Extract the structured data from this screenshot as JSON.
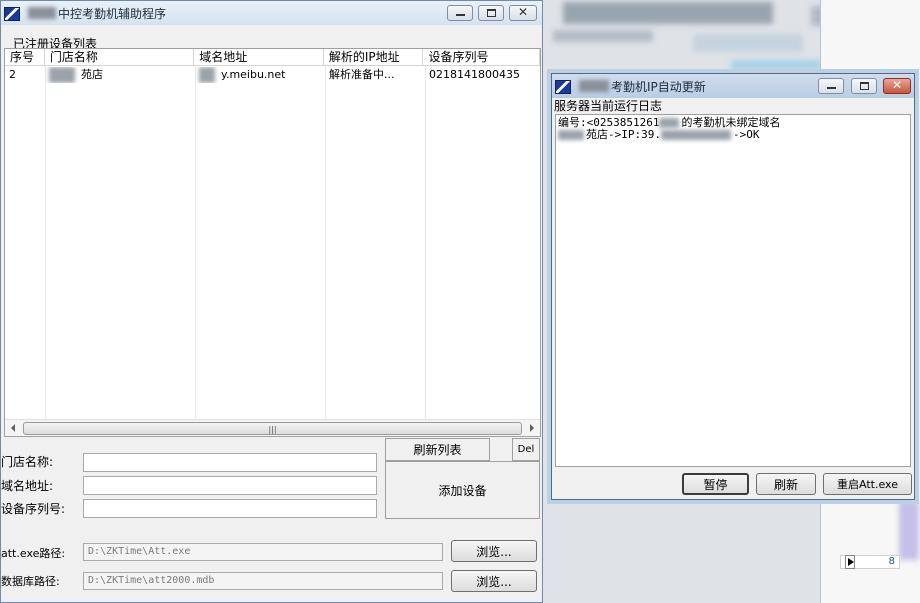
{
  "main_window": {
    "title": "中控考勤机辅助程序",
    "group_label": "已注册设备列表",
    "columns": [
      "序号",
      "门店名称",
      "域名地址",
      "解析的IP地址",
      "设备序列号"
    ],
    "rows": [
      {
        "index": "2",
        "store": "苑店",
        "domain": "y.meibu.net",
        "ip": "解析准备中...",
        "serial": "0218141800435"
      }
    ],
    "form": {
      "store_label": "门店名称:",
      "domain_label": "域名地址:",
      "serial_label": "设备序列号:",
      "store_value": "",
      "domain_value": "",
      "serial_value": ""
    },
    "buttons": {
      "refresh_list": "刷新列表",
      "delete": "Del",
      "add_device": "添加设备",
      "browse_1": "浏览...",
      "browse_2": "浏览..."
    },
    "paths": {
      "att_label": "att.exe路径:",
      "att_value": "D:\\ZKTime\\Att.exe",
      "db_label": "数据库路径:",
      "db_value": "D:\\ZKTime\\att2000.mdb"
    }
  },
  "sub_window": {
    "title": "考勤机IP自动更新",
    "log_label": "服务器当前运行日志",
    "log_lines": [
      "编号:<0253851261",
      "的考勤机未绑定域名",
      "苑店->IP:39.",
      "->OK"
    ],
    "buttons": {
      "pause": "暂停",
      "refresh": "刷新",
      "restart": "重启Att.exe"
    }
  },
  "background": {
    "cell_value": "8"
  }
}
